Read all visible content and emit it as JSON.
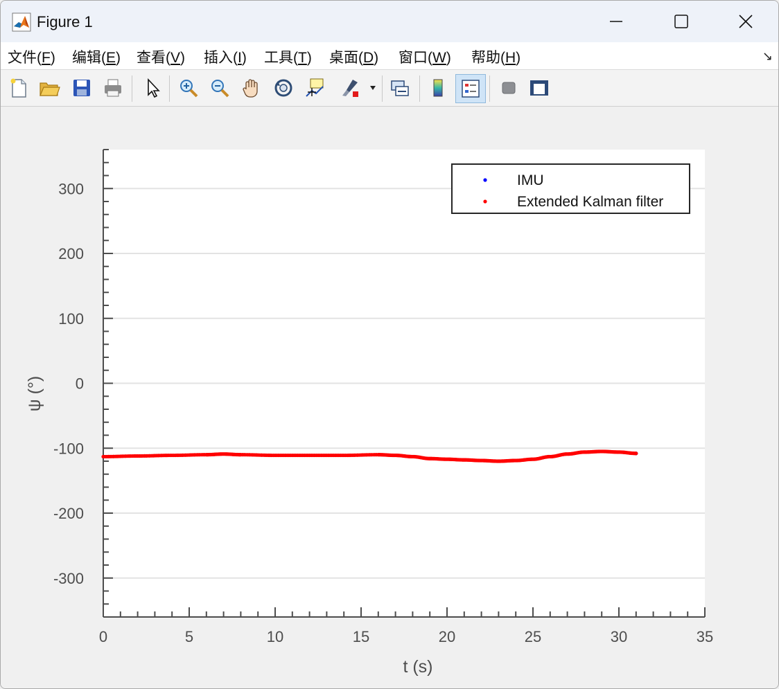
{
  "window": {
    "title": "Figure 1",
    "controls": [
      "minimize",
      "maximize",
      "close"
    ]
  },
  "menu": {
    "items": [
      {
        "label": "文件(",
        "key": "F",
        "suffix": ")"
      },
      {
        "label": "编辑(",
        "key": "E",
        "suffix": ")"
      },
      {
        "label": "查看(",
        "key": "V",
        "suffix": ")"
      },
      {
        "label": "插入(",
        "key": "I",
        "suffix": ")"
      },
      {
        "label": "工具(",
        "key": "T",
        "suffix": ")"
      },
      {
        "label": "桌面(",
        "key": "D",
        "suffix": ")"
      },
      {
        "label": "窗口(",
        "key": "W",
        "suffix": ")"
      },
      {
        "label": "帮助(",
        "key": "H",
        "suffix": ")"
      }
    ],
    "dock_arrow": "↘"
  },
  "toolbar": {
    "buttons": [
      {
        "icon": "new-figure-icon",
        "active": false
      },
      {
        "icon": "open-file-icon",
        "active": false
      },
      {
        "icon": "save-icon",
        "active": false
      },
      {
        "icon": "print-icon",
        "active": false
      },
      {
        "icon": "pointer-icon",
        "active": false
      },
      {
        "icon": "zoom-in-icon",
        "active": false
      },
      {
        "icon": "zoom-out-icon",
        "active": false
      },
      {
        "icon": "pan-hand-icon",
        "active": false
      },
      {
        "icon": "rotate-3d-icon",
        "active": false
      },
      {
        "icon": "data-cursor-icon",
        "active": false
      },
      {
        "icon": "brush-icon",
        "active": false
      },
      {
        "icon": "link-plot-icon",
        "active": false
      },
      {
        "icon": "colorbar-icon",
        "active": false
      },
      {
        "icon": "legend-icon",
        "active": true
      },
      {
        "icon": "hide-plot-tools-icon",
        "active": false
      },
      {
        "icon": "show-plot-tools-icon",
        "active": false
      }
    ]
  },
  "chart_data": {
    "type": "scatter",
    "title": "",
    "xlabel": "t (s)",
    "ylabel": "ψ (°)",
    "xlim": [
      0,
      35
    ],
    "ylim": [
      -360,
      360
    ],
    "xticks": [
      0,
      5,
      10,
      15,
      20,
      25,
      30,
      35
    ],
    "yticks": [
      -300,
      -200,
      -100,
      0,
      100,
      200,
      300
    ],
    "grid": "horizontal",
    "legend_position": "top-right",
    "series": [
      {
        "name": "IMU",
        "color": "#0000ff",
        "x": [
          0,
          2,
          4,
          6,
          7,
          8,
          10,
          12,
          14,
          16,
          17,
          18,
          19,
          20,
          21,
          22,
          23,
          24,
          25,
          26,
          27,
          28,
          29,
          30,
          31
        ],
        "y": [
          -113,
          -112,
          -111,
          -110,
          -109,
          -110,
          -111,
          -111,
          -111,
          -110,
          -111,
          -113,
          -116,
          -117,
          -118,
          -119,
          -120,
          -119,
          -117,
          -113,
          -109,
          -106,
          -105,
          -106,
          -108
        ]
      },
      {
        "name": "Extended Kalman filter",
        "color": "#ff0000",
        "x": [
          0,
          2,
          4,
          6,
          7,
          8,
          10,
          12,
          14,
          16,
          17,
          18,
          19,
          20,
          21,
          22,
          23,
          24,
          25,
          26,
          27,
          28,
          29,
          30,
          31
        ],
        "y": [
          -113,
          -112,
          -111,
          -110,
          -109,
          -110,
          -111,
          -111,
          -111,
          -110,
          -111,
          -113,
          -116,
          -117,
          -118,
          -119,
          -120,
          -119,
          -117,
          -113,
          -109,
          -106,
          -105,
          -106,
          -108
        ]
      }
    ]
  }
}
